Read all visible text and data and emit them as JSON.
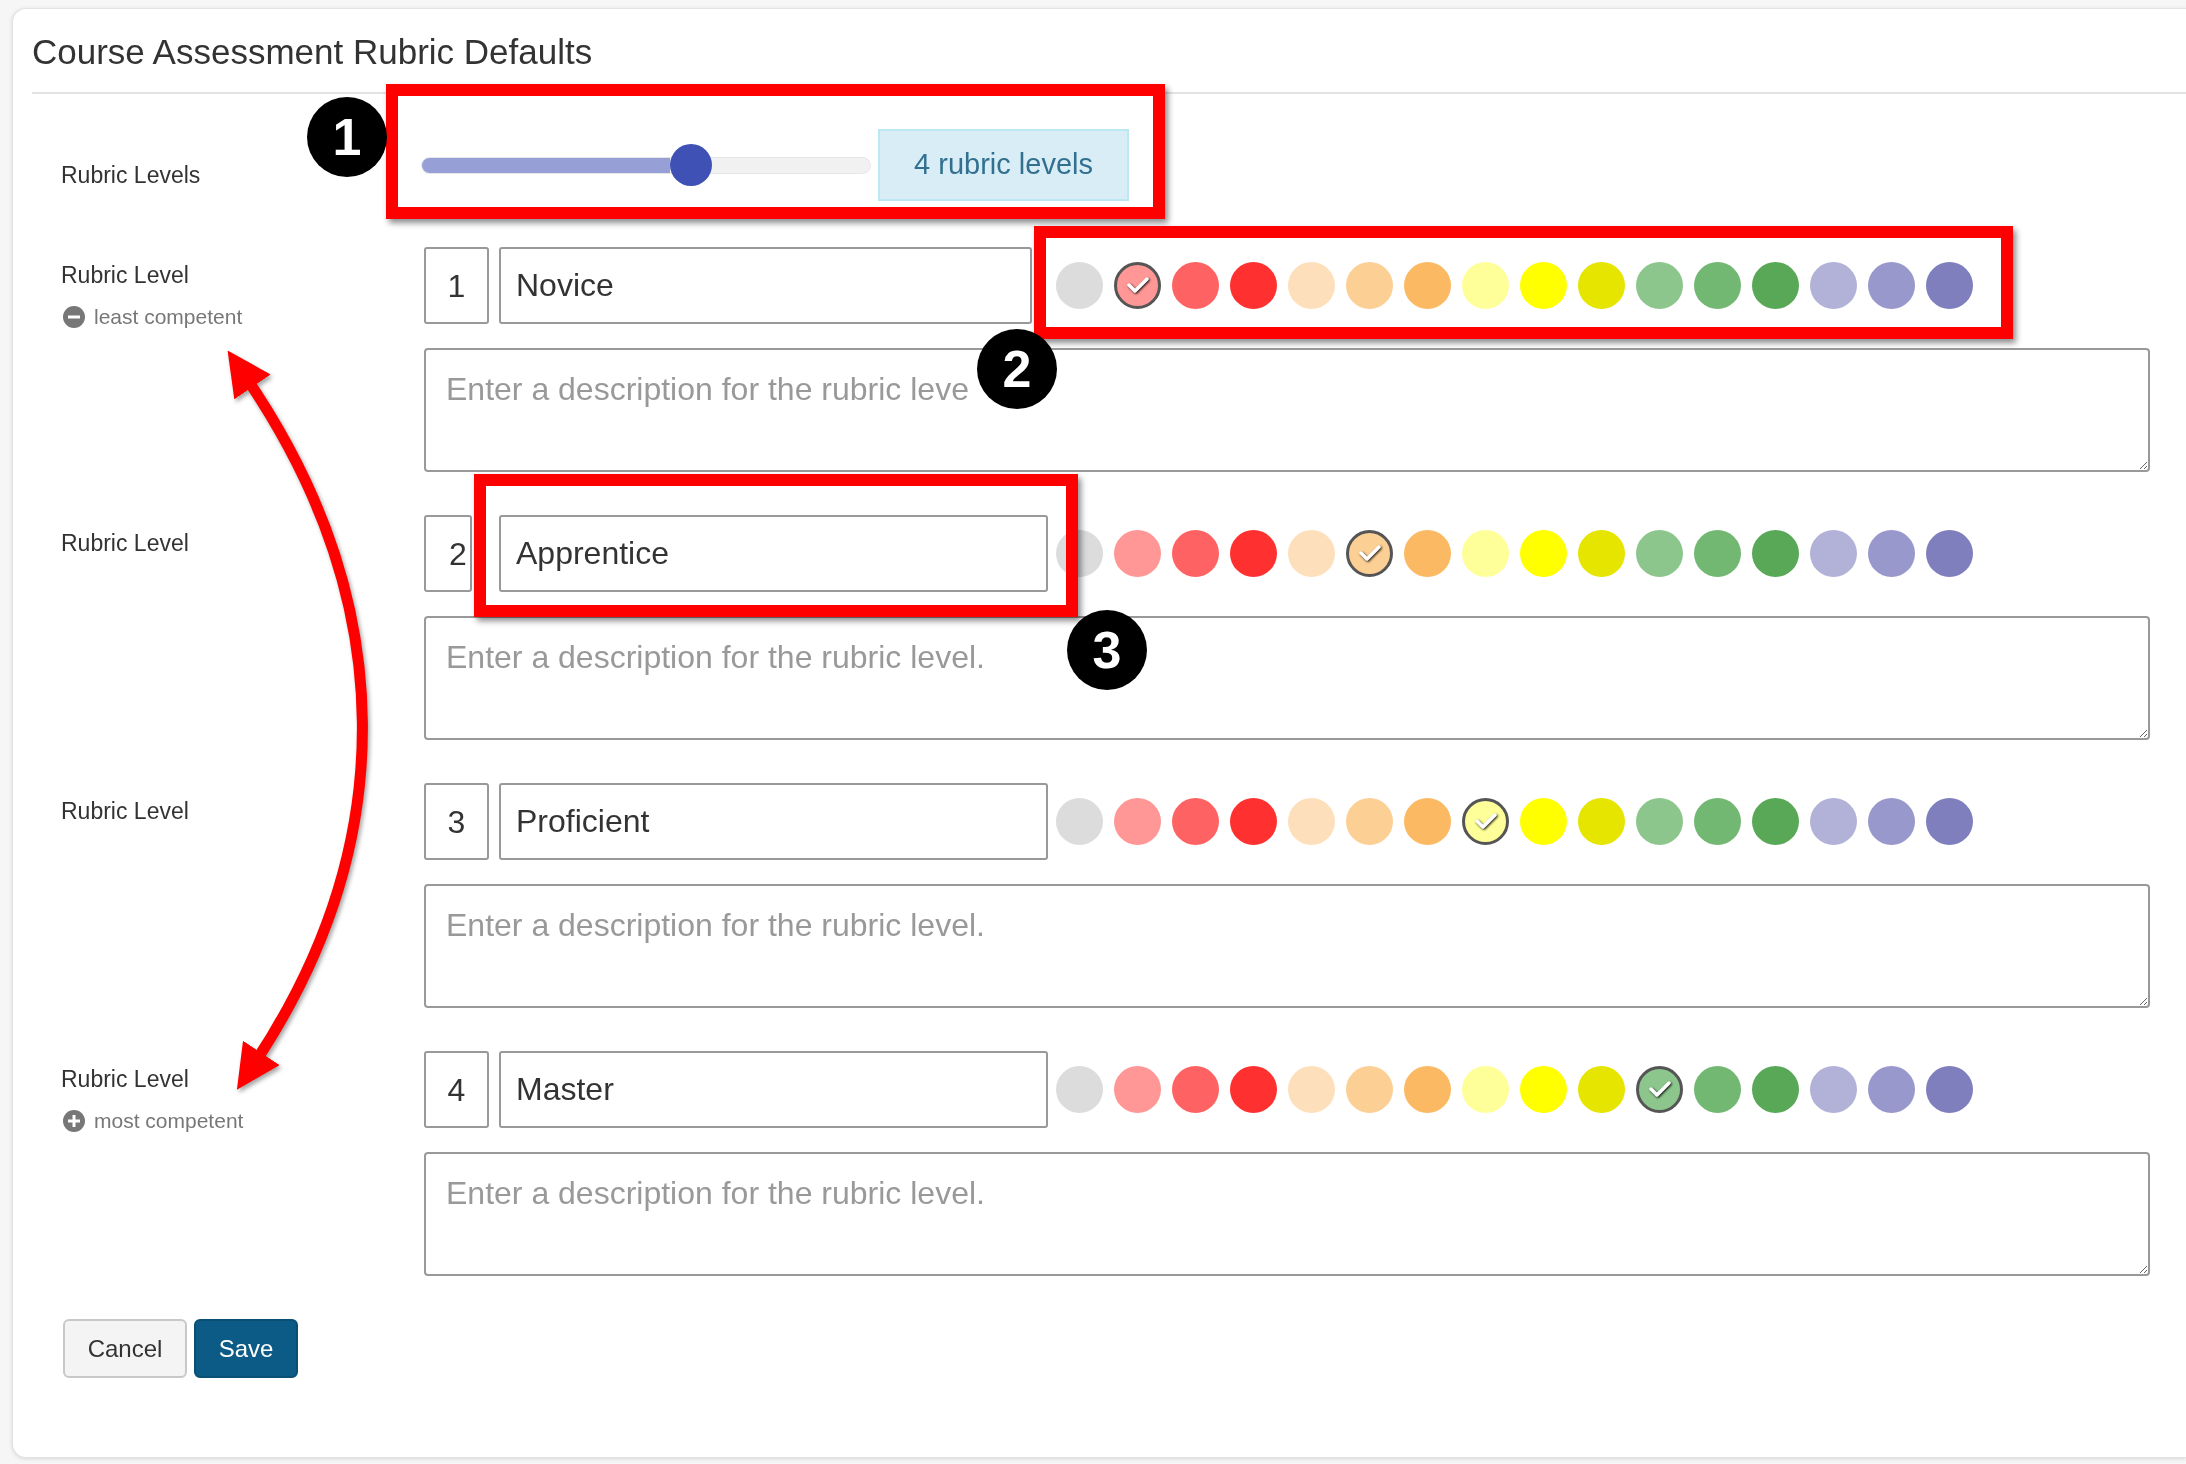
{
  "page_title": "Course Assessment Rubric Defaults",
  "rubric_levels": {
    "label": "Rubric Levels",
    "level": 0.6,
    "count_badge": "4 rubric levels"
  },
  "levels": [
    {
      "label": "Rubric Level",
      "hint": {
        "kind": "minus",
        "text": "least competent"
      },
      "number": "1",
      "name": "Novice",
      "description": {
        "placeholder": "Enter a description for the rubric leve"
      },
      "colors": [
        {
          "color": "#dcdcdc",
          "selected": false
        },
        {
          "color": "#ff9797",
          "selected": true
        },
        {
          "color": "#ff6262",
          "selected": false
        },
        {
          "color": "#ff3030",
          "selected": false
        },
        {
          "color": "#fde0bb",
          "selected": false
        },
        {
          "color": "#fccf94",
          "selected": false
        },
        {
          "color": "#fbb963",
          "selected": false
        },
        {
          "color": "#ffff99",
          "selected": false
        },
        {
          "color": "#ffff00",
          "selected": false
        },
        {
          "color": "#e5e500",
          "selected": false
        },
        {
          "color": "#8cc68c",
          "selected": false
        },
        {
          "color": "#72b872",
          "selected": false
        },
        {
          "color": "#58a858",
          "selected": false
        },
        {
          "color": "#b2b2d8",
          "selected": false
        },
        {
          "color": "#9898cc",
          "selected": false
        },
        {
          "color": "#7f7fbe",
          "selected": false
        }
      ]
    },
    {
      "label": "Rubric Level",
      "number": "2",
      "name": "Apprentice",
      "description": {
        "placeholder": "Enter a description for the rubric level."
      },
      "colors": [
        {
          "color": "#dcdcdc",
          "selected": false
        },
        {
          "color": "#ff9797",
          "selected": false
        },
        {
          "color": "#ff6262",
          "selected": false
        },
        {
          "color": "#ff3030",
          "selected": false
        },
        {
          "color": "#fde0bb",
          "selected": false
        },
        {
          "color": "#fccf94",
          "selected": true
        },
        {
          "color": "#fbb963",
          "selected": false
        },
        {
          "color": "#ffff99",
          "selected": false
        },
        {
          "color": "#ffff00",
          "selected": false
        },
        {
          "color": "#e5e500",
          "selected": false
        },
        {
          "color": "#8cc68c",
          "selected": false
        },
        {
          "color": "#72b872",
          "selected": false
        },
        {
          "color": "#58a858",
          "selected": false
        },
        {
          "color": "#b2b2d8",
          "selected": false
        },
        {
          "color": "#9898cc",
          "selected": false
        },
        {
          "color": "#7f7fbe",
          "selected": false
        }
      ]
    },
    {
      "label": "Rubric Level",
      "number": "3",
      "name": "Proficient",
      "description": {
        "placeholder": "Enter a description for the rubric level."
      },
      "colors": [
        {
          "color": "#dcdcdc",
          "selected": false
        },
        {
          "color": "#ff9797",
          "selected": false
        },
        {
          "color": "#ff6262",
          "selected": false
        },
        {
          "color": "#ff3030",
          "selected": false
        },
        {
          "color": "#fde0bb",
          "selected": false
        },
        {
          "color": "#fccf94",
          "selected": false
        },
        {
          "color": "#fbb963",
          "selected": false
        },
        {
          "color": "#ffff99",
          "selected": true
        },
        {
          "color": "#ffff00",
          "selected": false
        },
        {
          "color": "#e5e500",
          "selected": false
        },
        {
          "color": "#8cc68c",
          "selected": false
        },
        {
          "color": "#72b872",
          "selected": false
        },
        {
          "color": "#58a858",
          "selected": false
        },
        {
          "color": "#b2b2d8",
          "selected": false
        },
        {
          "color": "#9898cc",
          "selected": false
        },
        {
          "color": "#7f7fbe",
          "selected": false
        }
      ]
    },
    {
      "label": "Rubric Level",
      "hint": {
        "kind": "plus",
        "text": "most competent"
      },
      "number": "4",
      "name": "Master",
      "description": {
        "placeholder": "Enter a description for the rubric level."
      },
      "colors": [
        {
          "color": "#dcdcdc",
          "selected": false
        },
        {
          "color": "#ff9797",
          "selected": false
        },
        {
          "color": "#ff6262",
          "selected": false
        },
        {
          "color": "#ff3030",
          "selected": false
        },
        {
          "color": "#fde0bb",
          "selected": false
        },
        {
          "color": "#fccf94",
          "selected": false
        },
        {
          "color": "#fbb963",
          "selected": false
        },
        {
          "color": "#ffff99",
          "selected": false
        },
        {
          "color": "#ffff00",
          "selected": false
        },
        {
          "color": "#e5e500",
          "selected": false
        },
        {
          "color": "#8cc68c",
          "selected": true
        },
        {
          "color": "#72b872",
          "selected": false
        },
        {
          "color": "#58a858",
          "selected": false
        },
        {
          "color": "#b2b2d8",
          "selected": false
        },
        {
          "color": "#9898cc",
          "selected": false
        },
        {
          "color": "#7f7fbe",
          "selected": false
        }
      ]
    }
  ],
  "buttons": [
    {
      "kind": "secondary",
      "label": "Cancel"
    },
    {
      "kind": "primary",
      "label": "Save"
    }
  ],
  "annotations": {
    "callouts": [
      {
        "label": "1"
      },
      {
        "label": "2"
      },
      {
        "label": "3"
      }
    ]
  }
}
